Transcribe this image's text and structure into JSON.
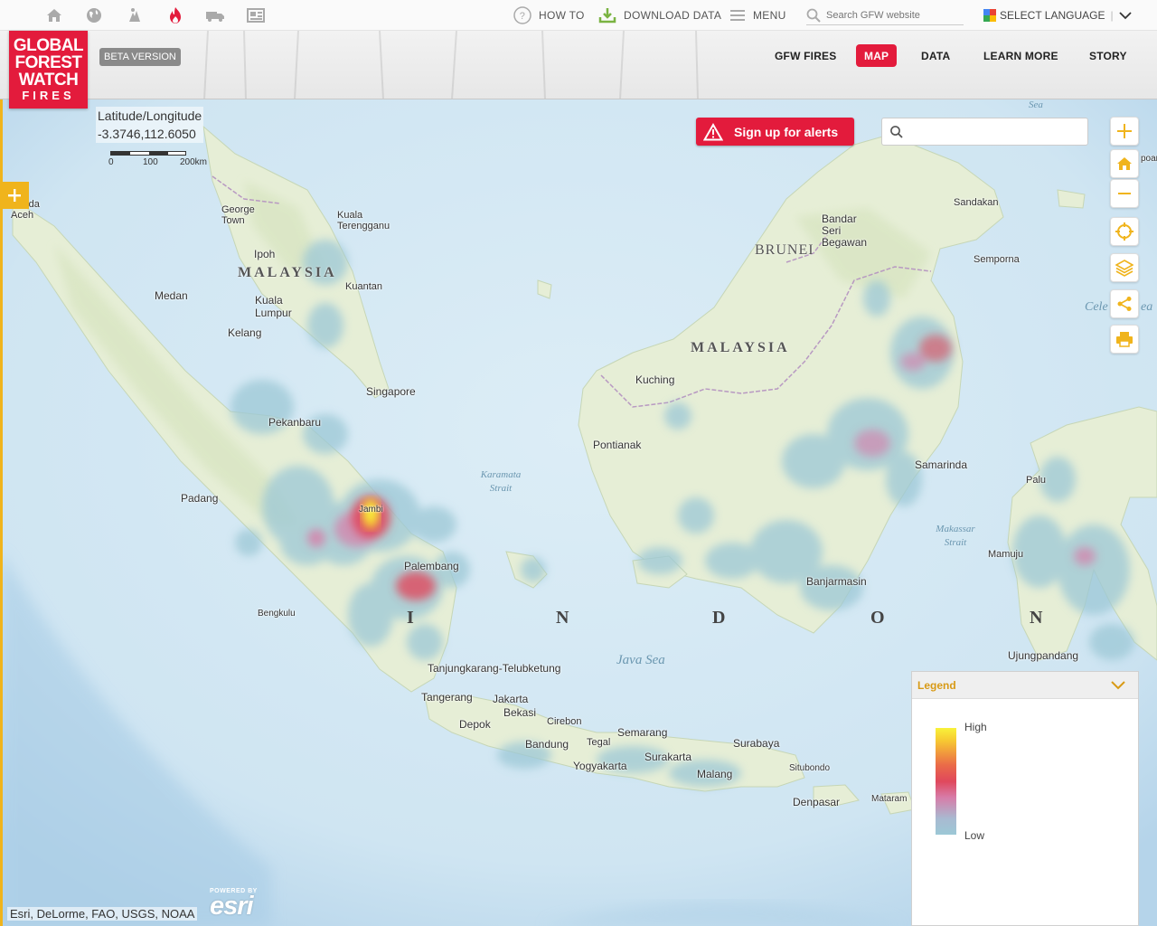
{
  "topbar": {
    "icons": [
      "home-icon",
      "globe-icon",
      "climate-icon",
      "fire-icon",
      "truck-icon",
      "news-icon"
    ],
    "how_to": "HOW TO",
    "download": "DOWNLOAD DATA",
    "menu": "MENU",
    "search_placeholder": "Search GFW website",
    "language": "SELECT LANGUAGE"
  },
  "header": {
    "logo_lines": [
      "GLOBAL",
      "FOREST",
      "WATCH",
      "FIRES"
    ],
    "beta": "BETA VERSION",
    "nav": [
      {
        "label": "GFW FIRES",
        "active": false
      },
      {
        "label": "MAP",
        "active": true
      },
      {
        "label": "DATA",
        "active": false
      },
      {
        "label": "LEARN MORE",
        "active": false
      },
      {
        "label": "STORY",
        "active": false
      }
    ],
    "accent": "#e31b3c"
  },
  "map": {
    "latlon_label": "Latitude/Longitude",
    "latlon_value": "-3.3746,112.6050",
    "scale_labels": [
      "0",
      "100",
      "200km"
    ],
    "alerts_button": "Sign up for alerts",
    "search_placeholder": "",
    "controls": [
      "zoom-in",
      "home",
      "zoom-out",
      "locate",
      "layers",
      "share",
      "print"
    ],
    "attribution": "Esri, DeLorme, FAO, USGS, NOAA",
    "esri_powered": "POWERED BY",
    "esri_name": "esri",
    "colors": {
      "water": "#cfe5f2",
      "land": "#e6eed6",
      "heat_high": "#f8f23a",
      "heat_mid": "#e0485c",
      "heat_low": "#9cc8d6",
      "legend_title": "#d89a16"
    },
    "places": [
      "Banda Aceh",
      "Medan",
      "George Town",
      "Kuala Terengganu",
      "Ipoh",
      "Kuantan",
      "Kuala Lumpur",
      "Kelang",
      "Singapore",
      "Pekanbaru",
      "Padang",
      "Jambi",
      "Palembang",
      "Bengkulu",
      "Tanjungkarang-Telubketung",
      "Tangerang",
      "Jakarta",
      "Bekasi",
      "Depok",
      "Cirebon",
      "Bandung",
      "Tegal",
      "Semarang",
      "Surakarta",
      "Yogyakarta",
      "Malang",
      "Surabaya",
      "Situbondo",
      "Denpasar",
      "Mataram",
      "Kuching",
      "Pontianak",
      "Banjarmasin",
      "Samarinda",
      "Sandakan",
      "Bandar Seri Begawan",
      "Semporna",
      "Palu",
      "Mamuju",
      "Ujungpandang"
    ],
    "countries": [
      "MALAYSIA",
      "MALAYSIA",
      "BRUNEI"
    ],
    "indonesia_letters": [
      "I",
      "N",
      "D",
      "O",
      "N"
    ],
    "seas": [
      "Karamata Strait",
      "Java Sea",
      "Makassar Strait",
      "Sea",
      "Cele",
      "ea",
      "poar"
    ]
  },
  "legend": {
    "title": "Legend",
    "high": "High",
    "low": "Low"
  }
}
